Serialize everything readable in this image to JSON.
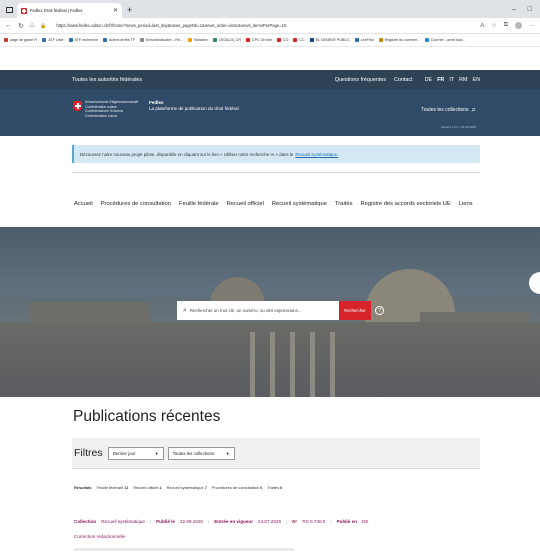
{
  "browser": {
    "tab_title": "Fedlex Droit fédéral | Fedlex",
    "new_tab_glyph": "+",
    "url": "https://www.fedlex.admin.ch/fr/home?news_period=last_day&news_pageNb=1&news_order=desc&news_itemsPerPage=10",
    "window_controls": [
      "–",
      "□"
    ],
    "bookmarks": [
      "page de garde FI",
      "ATF Liste",
      "ATF recherche",
      "Autres arrêts TF",
      "Entscheidsuche – Re...",
      "Swisslex",
      "LEGALIS_CR",
      "CPC On line",
      "CO",
      "CC",
      "BL GENEVE PUBLIC",
      "LexFind",
      "Registre du commer...",
      "Courrier - anne.duiv..."
    ]
  },
  "topbar": {
    "left": "Toutes les autorités fédérales",
    "faq": "Questions fréquentes",
    "contact": "Contact",
    "languages": [
      "DE",
      "FR",
      "IT",
      "RM",
      "EN"
    ],
    "active_language": "FR"
  },
  "header": {
    "confed_lines": [
      "Schweizerische Eidgenossenschaft",
      "Confédération suisse",
      "Confederazione Svizzera",
      "Confederaziun svizra"
    ],
    "brand_name": "Fedlex",
    "brand_tagline": "La plateforme de publication du droit fédéral",
    "all_collections": "Toutes les collections",
    "version": "Version 2.5.0 - 18.06.2025"
  },
  "notice": {
    "text": "Découvrez notre nouveau projet pilote, disponible en cliquant sur le lien « Utiliser notre recherche IA » dans le",
    "link": "Recueil systématique."
  },
  "nav": [
    "Accueil",
    "Procédures de consultation",
    "Feuille fédérale",
    "Recueil officiel",
    "Recueil systématique",
    "Traités",
    "Registre des accords sectoriels UE",
    "Liens"
  ],
  "search": {
    "placeholder": "Rechercher un mot clé, un numéro, ou des expressions...",
    "button": "Rechercher",
    "help": "?"
  },
  "publications": {
    "title": "Publications récentes",
    "filters_label": "Filtres",
    "period_select": "Dernier jour",
    "collection_select": "Toutes les collections",
    "results_label": "Résultats",
    "counts": [
      {
        "name": "Feuille fédérale",
        "count": "11"
      },
      {
        "name": "Recueil officiel",
        "count": "2"
      },
      {
        "name": "Recueil systématique",
        "count": "7"
      },
      {
        "name": "Procédures de consultation",
        "count": "0"
      },
      {
        "name": "Traités",
        "count": "0"
      }
    ],
    "entry": {
      "collection_label": "Collection",
      "collection_value": "Recueil systématique",
      "published_label": "Publié le",
      "published_value": "22.09.2025",
      "in_force_label": "Entrée en vigueur",
      "in_force_value": "24.07.2025",
      "number_label": "N°",
      "number_value": "RS 0.730.0",
      "published_in_label": "Publié en",
      "published_in_value": "DE",
      "correction": "Correction rédactionnelle"
    }
  },
  "colors": {
    "topbar": "#2f4356",
    "header": "#2f4b67",
    "accent_red": "#d8232a",
    "entry_purple": "#8e1a5a",
    "notice_bg": "#d3e8f2"
  }
}
